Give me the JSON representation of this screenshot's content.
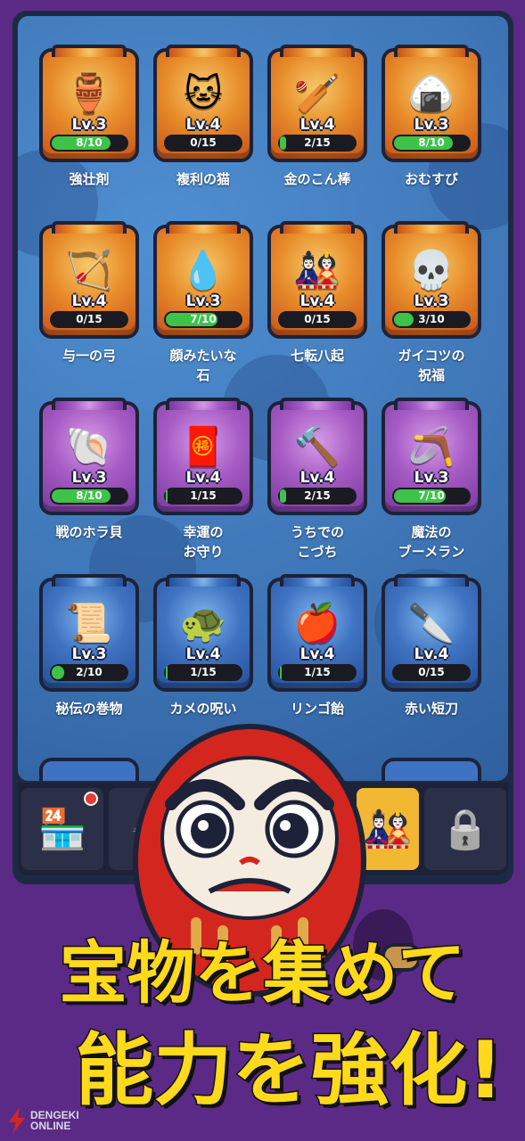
{
  "items": [
    {
      "icon": "🏺",
      "icon_name": "jar-icon",
      "level": "Lv.3",
      "progress": "8/10",
      "fill": 0.8,
      "name": "強壮剤",
      "rarity": "orange"
    },
    {
      "icon": "🐱",
      "icon_name": "lucky-cat-icon",
      "level": "Lv.4",
      "progress": "0/15",
      "fill": 0.0,
      "name": "複利の猫",
      "rarity": "orange"
    },
    {
      "icon": "🏏",
      "icon_name": "golden-club-icon",
      "level": "Lv.4",
      "progress": "2/15",
      "fill": 0.13,
      "name": "金のこん棒",
      "rarity": "orange"
    },
    {
      "icon": "🍙",
      "icon_name": "rice-ball-icon",
      "level": "Lv.3",
      "progress": "8/10",
      "fill": 0.8,
      "name": "おむすび",
      "rarity": "orange"
    },
    {
      "icon": "🏹",
      "icon_name": "bow-icon",
      "level": "Lv.4",
      "progress": "0/15",
      "fill": 0.0,
      "name": "与一の弓",
      "rarity": "orange"
    },
    {
      "icon": "💧",
      "icon_name": "water-drop-icon",
      "level": "Lv.3",
      "progress": "7/10",
      "fill": 0.7,
      "name": "顔みたいな\n石",
      "rarity": "orange"
    },
    {
      "icon": "🎎",
      "icon_name": "daruma-doll-icon",
      "level": "Lv.4",
      "progress": "0/15",
      "fill": 0.0,
      "name": "七転八起",
      "rarity": "orange"
    },
    {
      "icon": "💀",
      "icon_name": "skull-icon",
      "level": "Lv.3",
      "progress": "3/10",
      "fill": 0.3,
      "name": "ガイコツの\n祝福",
      "rarity": "orange"
    },
    {
      "icon": "🐚",
      "icon_name": "conch-shell-icon",
      "level": "Lv.3",
      "progress": "8/10",
      "fill": 0.8,
      "name": "戦のホラ貝",
      "rarity": "purple"
    },
    {
      "icon": "🧧",
      "icon_name": "amulet-icon",
      "level": "Lv.4",
      "progress": "1/15",
      "fill": 0.07,
      "name": "幸運の\nお守り",
      "rarity": "purple"
    },
    {
      "icon": "🔨",
      "icon_name": "mallet-icon",
      "level": "Lv.4",
      "progress": "2/15",
      "fill": 0.13,
      "name": "うちでの\nこづち",
      "rarity": "purple"
    },
    {
      "icon": "🪃",
      "icon_name": "boomerang-icon",
      "level": "Lv.3",
      "progress": "7/10",
      "fill": 0.7,
      "name": "魔法の\nブーメラン",
      "rarity": "purple"
    },
    {
      "icon": "📜",
      "icon_name": "scroll-icon",
      "level": "Lv.3",
      "progress": "2/10",
      "fill": 0.2,
      "name": "秘伝の巻物",
      "rarity": "blue"
    },
    {
      "icon": "🐢",
      "icon_name": "turtle-icon",
      "level": "Lv.4",
      "progress": "1/15",
      "fill": 0.07,
      "name": "カメの呪い",
      "rarity": "blue"
    },
    {
      "icon": "🍎",
      "icon_name": "candy-apple-icon",
      "level": "Lv.4",
      "progress": "1/15",
      "fill": 0.07,
      "name": "リンゴ飴",
      "rarity": "blue"
    },
    {
      "icon": "🔪",
      "icon_name": "short-sword-icon",
      "level": "Lv.4",
      "progress": "0/15",
      "fill": 0.0,
      "name": "赤い短刀",
      "rarity": "blue"
    }
  ],
  "nav": [
    {
      "icon": "🏪",
      "icon_name": "shop-icon"
    },
    {
      "icon": "🐇",
      "icon_name": "rabbit-icon"
    },
    {
      "icon": "🎎",
      "icon_name": "treasure-icon"
    },
    {
      "icon": "🔒",
      "icon_name": "lock-icon"
    }
  ],
  "headline": {
    "line1": "宝物を集めて",
    "line2": "能力を強化!"
  },
  "watermark": {
    "line1": "DENGEKI",
    "line2": "ONLINE"
  },
  "colors": {
    "background": "#5b2a86",
    "headline": "#ffd91c",
    "progress": "#3ec24a"
  }
}
